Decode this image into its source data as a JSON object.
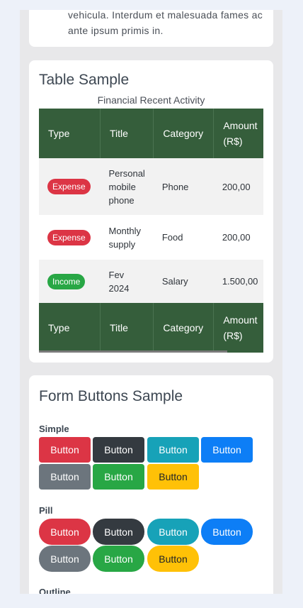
{
  "top_card": {
    "text": "vehicula. Interdum et malesuada fames ac ante ipsum primis in."
  },
  "table_card": {
    "title": "Table Sample",
    "caption": "Financial Recent Activity",
    "headers": [
      "Type",
      "Title",
      "Category",
      "Amount (R$)"
    ],
    "rows": [
      {
        "type": "Expense",
        "title": "Personal mobile phone",
        "category": "Phone",
        "amount": "200,00"
      },
      {
        "type": "Expense",
        "title": "Monthly supply",
        "category": "Food",
        "amount": "200,00"
      },
      {
        "type": "Income",
        "title": "Fev 2024",
        "category": "Salary",
        "amount": "1.500,00"
      }
    ],
    "footer": [
      "Type",
      "Title",
      "Category",
      "Amount (R$)"
    ]
  },
  "form_card": {
    "title": "Form Buttons Sample",
    "simple_label": "Simple",
    "pill_label": "Pill",
    "outline_label": "Outline",
    "button_label": "Button"
  },
  "colors": {
    "header_green": "#355e3b",
    "danger": "#dc3545",
    "dark": "#343a40",
    "info": "#17a2b8",
    "primary": "#0d7ef6",
    "secondary": "#6c757d",
    "success": "#28a745",
    "warning": "#ffc107"
  }
}
